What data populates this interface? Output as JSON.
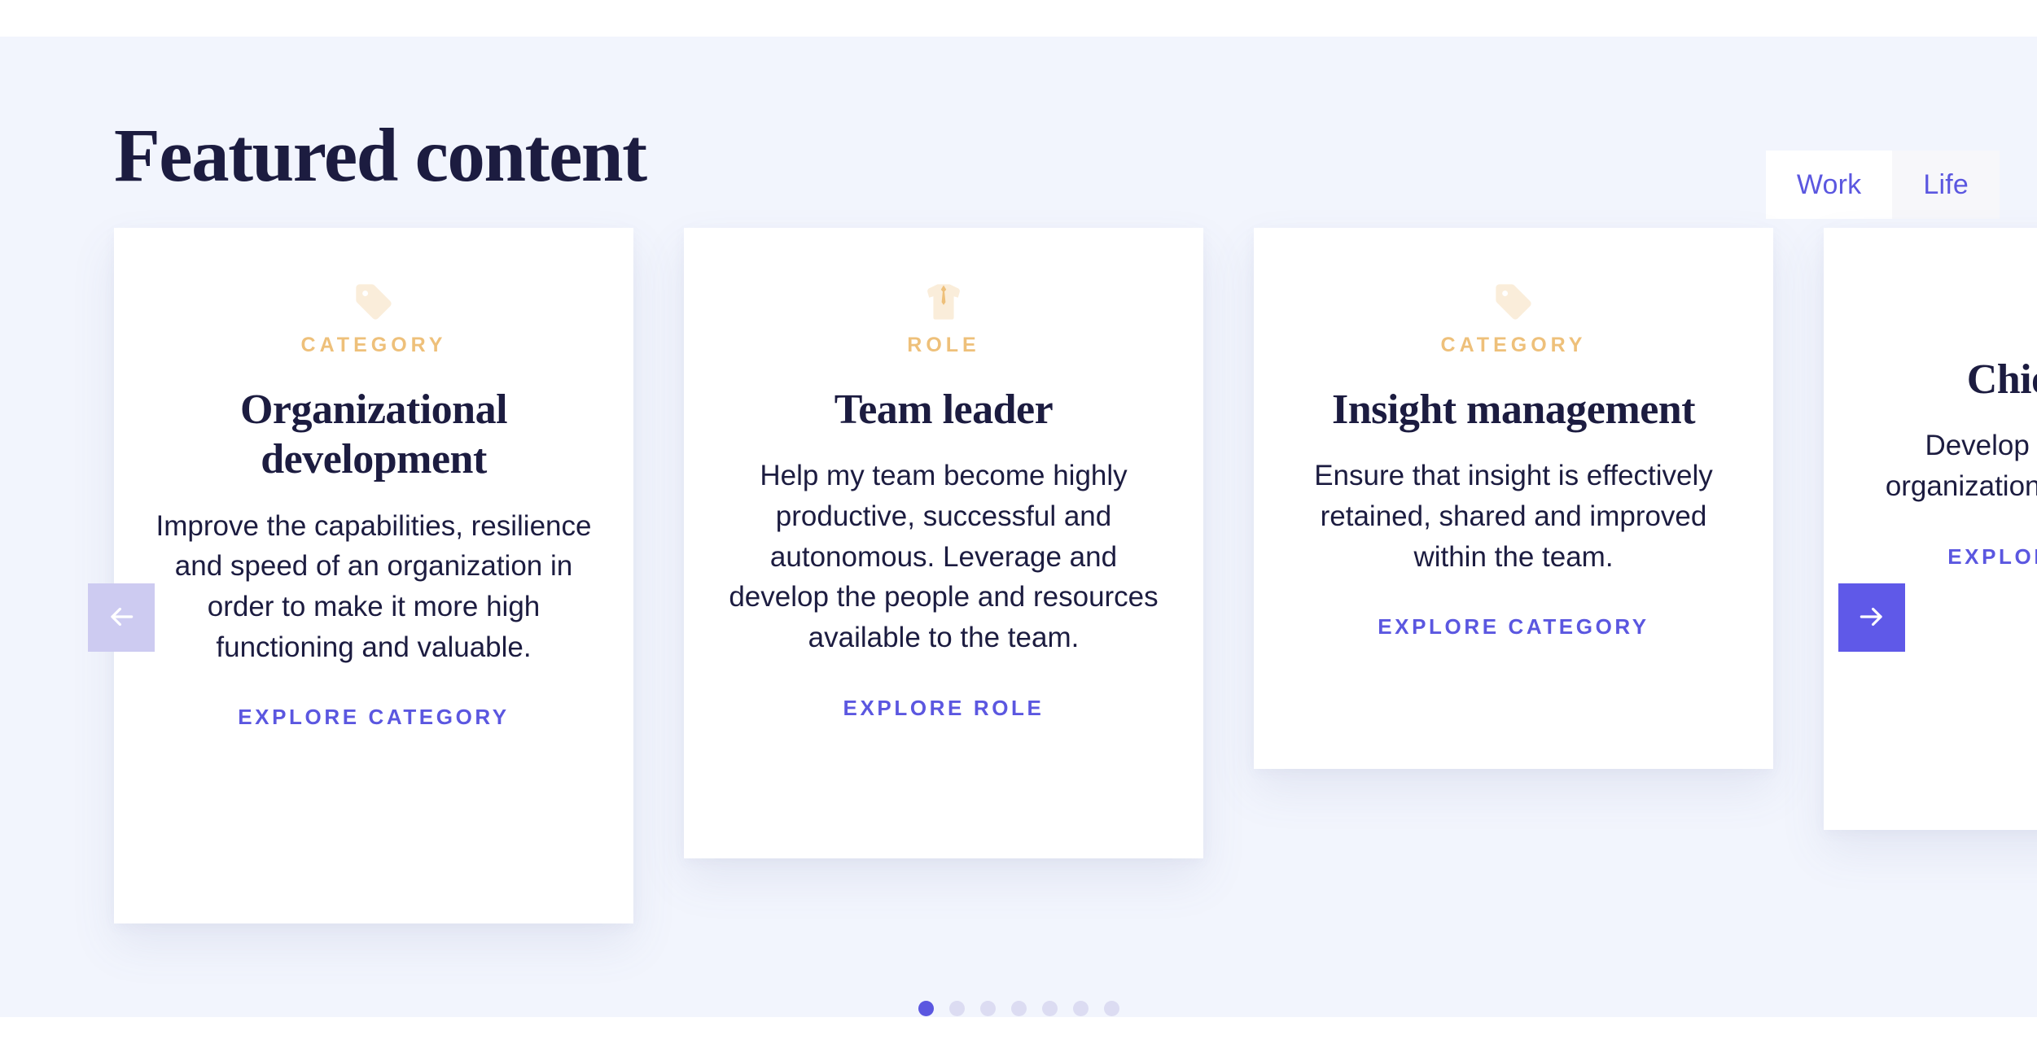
{
  "header": {
    "title": "Featured content",
    "toggle": {
      "options": [
        {
          "label": "Work",
          "active": true
        },
        {
          "label": "Life",
          "active": false
        }
      ]
    }
  },
  "carousel": {
    "prev_label": "Previous",
    "next_label": "Next",
    "colors": {
      "accent": "#5b57e0",
      "accent_muted": "#cdcbf1",
      "kicker": "#eec07a",
      "icon_fill": "#faedda",
      "title": "#1c1c40",
      "background": "#f2f5fd",
      "card": "#ffffff"
    },
    "cards": [
      {
        "icon": "tag-icon",
        "kicker": "CATEGORY",
        "title": "Organizational development",
        "body": "Improve the capabilities, resilience and speed of an organization in order to make it more high functioning and valuable.",
        "link": "EXPLORE CATEGORY"
      },
      {
        "icon": "shirt-tie-icon",
        "kicker": "ROLE",
        "title": "Team leader",
        "body": "Help my team become highly productive, successful and autonomous. Leverage and develop the people and resources available to the team.",
        "link": "EXPLORE ROLE"
      },
      {
        "icon": "tag-icon",
        "kicker": "CATEGORY",
        "title": "Insight management",
        "body": "Ensure that insight is effectively retained, shared and improved within the team.",
        "link": "EXPLORE CATEGORY"
      },
      {
        "icon": "tag-icon",
        "kicker": "",
        "title": "Chief Officer",
        "body": "Develop a highly resilient organization with a clear vision.",
        "link": "EXPLORE CATEGORY"
      }
    ],
    "pagination": {
      "count": 7,
      "active_index": 0
    }
  }
}
